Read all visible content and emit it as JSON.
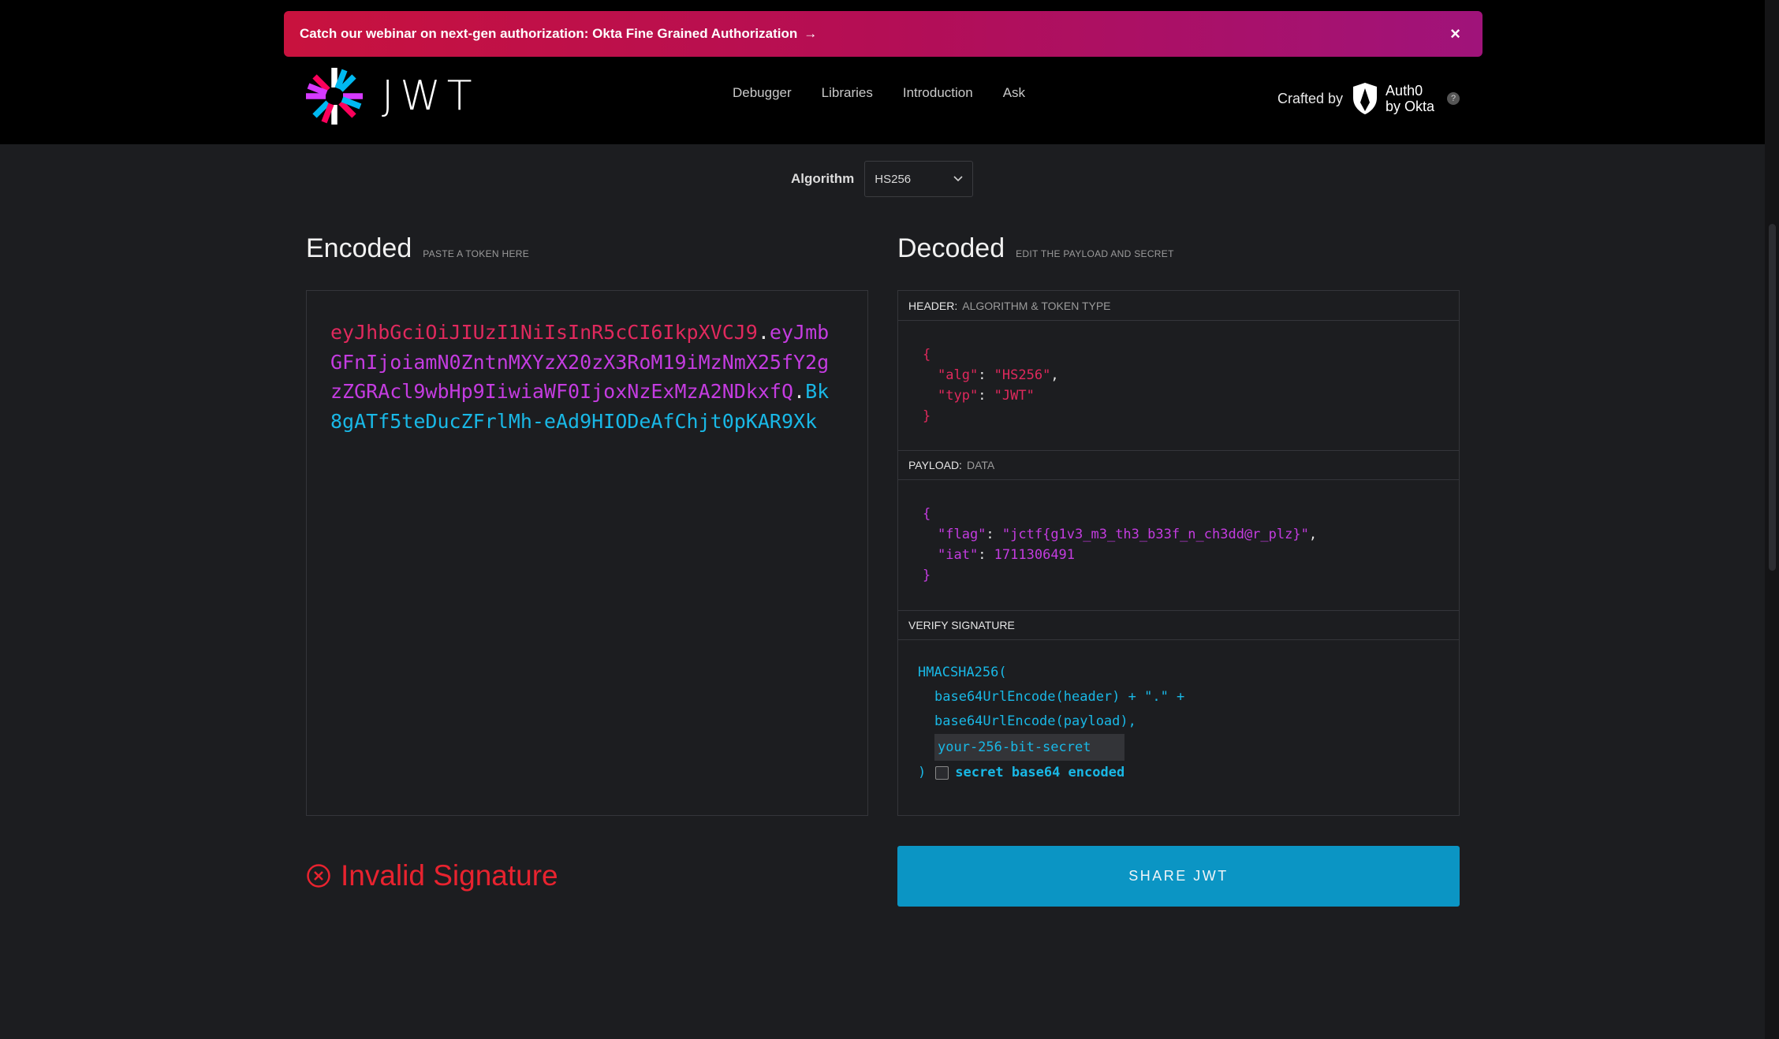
{
  "banner": {
    "text": "Catch our webinar on next-gen authorization: Okta Fine Grained Authorization",
    "arrow": "→",
    "close": "×"
  },
  "logo": {
    "text": "JWT"
  },
  "nav": {
    "items": [
      "Debugger",
      "Libraries",
      "Introduction",
      "Ask"
    ]
  },
  "crafted": {
    "label": "Crafted by",
    "brand_line1": "Auth0",
    "brand_line2": "by Okta",
    "help": "?"
  },
  "algorithm": {
    "label": "Algorithm",
    "selected": "HS256"
  },
  "encoded": {
    "title": "Encoded",
    "subtitle": "PASTE A TOKEN HERE",
    "token_header": "eyJhbGciOiJIUzI1NiIsInR5cCI6IkpXVCJ9",
    "token_payload": "eyJmbGFnIjoiamN0ZntnMXYzX20zX3RoM19iMzNmX25fY2gzZGRAcl9wbHp9IiwiaWF0IjoxNzExMzA2NDkxfQ",
    "token_signature": "Bk8gATf5teDucZFrlMh-eAd9HIODeAfChjt0pKAR9Xk"
  },
  "decoded": {
    "title": "Decoded",
    "subtitle": "EDIT THE PAYLOAD AND SECRET",
    "header_label": "HEADER:",
    "header_sub": "ALGORITHM & TOKEN TYPE",
    "header_json": {
      "alg_key": "\"alg\"",
      "alg_val": "\"HS256\"",
      "typ_key": "\"typ\"",
      "typ_val": "\"JWT\""
    },
    "payload_label": "PAYLOAD:",
    "payload_sub": "DATA",
    "payload_json": {
      "flag_key": "\"flag\"",
      "flag_val": "\"jctf{g1v3_m3_th3_b33f_n_ch3dd@r_plz}\"",
      "iat_key": "\"iat\"",
      "iat_val": "1711306491"
    },
    "verify_label": "VERIFY SIGNATURE",
    "sig_fn": "HMACSHA256(",
    "sig_line1": "base64UrlEncode(header) + \".\" +",
    "sig_line2": "base64UrlEncode(payload),",
    "secret_placeholder": "your-256-bit-secret",
    "sig_close": ")",
    "b64_label": "secret base64 encoded"
  },
  "status": {
    "text": "Invalid Signature",
    "color": "#e8232f"
  },
  "share": {
    "label": "SHARE JWT"
  }
}
